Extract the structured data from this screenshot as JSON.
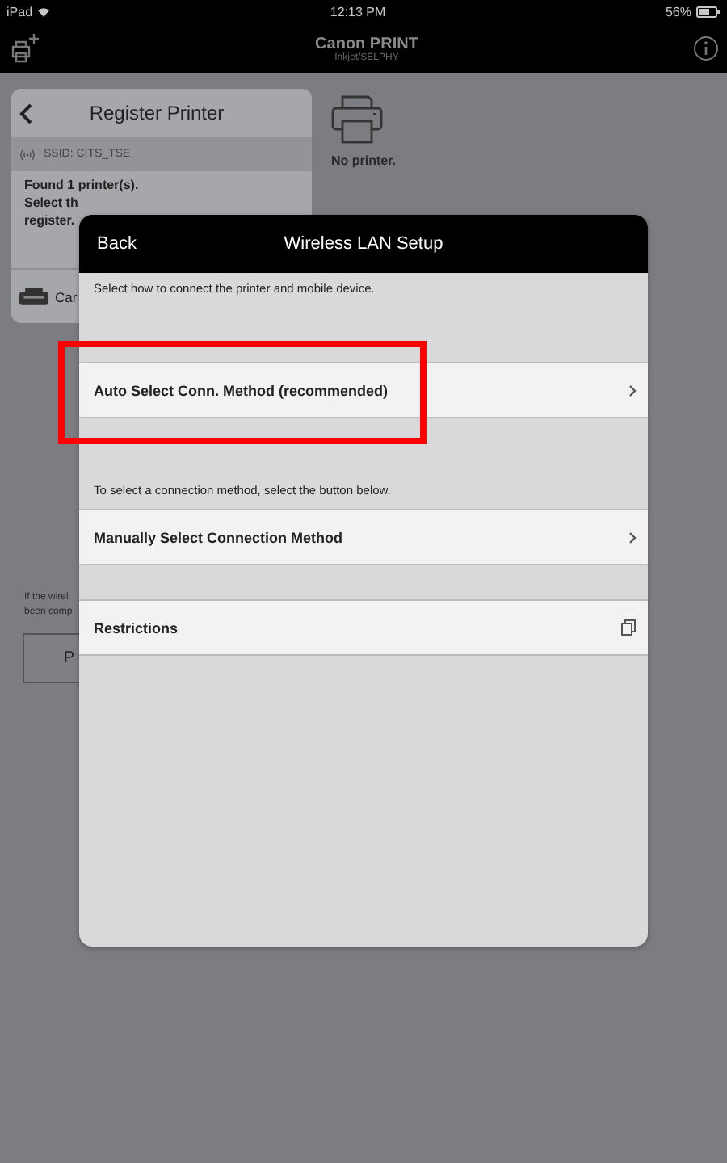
{
  "status_bar": {
    "device": "iPad",
    "time": "12:13 PM",
    "battery": "56%"
  },
  "nav_bar": {
    "title": "Canon PRINT",
    "subtitle": "Inkjet/SELPHY"
  },
  "background": {
    "register_panel": {
      "title": "Register Printer",
      "ssid": "SSID: CITS_TSE",
      "found": "Found 1 printer(s).",
      "lines": [
        "Select th",
        "register."
      ],
      "printer_item": "Car"
    },
    "no_printer": "No printer.",
    "hint_lines": [
      "If the wirel",
      "been comp"
    ],
    "button": "P"
  },
  "dialog": {
    "back": "Back",
    "title": "Wireless LAN Setup",
    "sections": [
      {
        "note": "Select how to connect the printer and mobile device.",
        "rows": [
          {
            "label": "Auto Select Conn. Method (recommended)",
            "kind": "chevron",
            "highlighted": true
          }
        ]
      },
      {
        "note": "To select a connection method, select the button below.",
        "rows": [
          {
            "label": "Manually Select Connection Method",
            "kind": "chevron",
            "highlighted": false
          }
        ]
      },
      {
        "rows": [
          {
            "label": "Restrictions",
            "kind": "external",
            "highlighted": false
          }
        ]
      }
    ]
  }
}
